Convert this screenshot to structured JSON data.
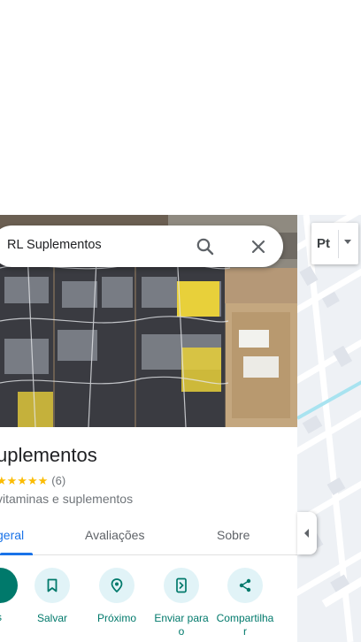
{
  "search": {
    "query": "RL Suplementos"
  },
  "layer_control": {
    "label": "Pt"
  },
  "place": {
    "title": "uplementos",
    "stars": "★★★★★",
    "review_count": "(6)",
    "category": "vitaminas e suplementos"
  },
  "tabs": {
    "overview": "geral",
    "reviews": "Avaliações",
    "about": "Sobre"
  },
  "actions": {
    "first_label": "s",
    "save": "Salvar",
    "nearby": "Próximo",
    "send_line1": "Enviar para",
    "send_line2": "o",
    "share_line1": "Compartilha",
    "share_line2": "r"
  },
  "colors": {
    "accent": "#1a73e8",
    "action_text": "#00796b",
    "action_bg": "#e1f3f7",
    "star": "#fbbc04"
  },
  "icons": [
    "search-icon",
    "close-icon",
    "bookmark-icon",
    "nearby-icon",
    "send-to-phone-icon",
    "share-icon",
    "chevron-left-icon"
  ]
}
